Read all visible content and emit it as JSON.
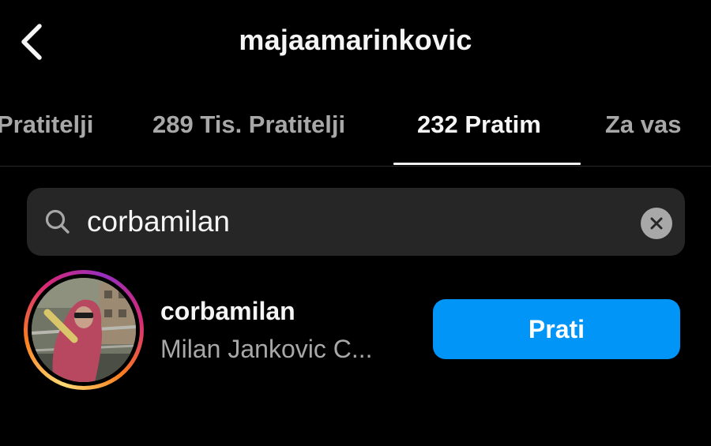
{
  "header": {
    "title": "majaamarinkovic",
    "back_icon": "chevron-left-icon"
  },
  "tabs": [
    {
      "label": "Pratitelji",
      "active": false
    },
    {
      "label": "289 Tis. Pratitelji",
      "active": false
    },
    {
      "label": "232 Pratim",
      "active": true
    },
    {
      "label": "Za vas",
      "active": false
    }
  ],
  "search": {
    "value": "corbamilan",
    "icon": "search-icon",
    "clear_icon": "clear-icon"
  },
  "result": {
    "username": "corbamilan",
    "full_name": "Milan Jankovic C...",
    "follow_label": "Prati",
    "follow_color": "#0095f6"
  },
  "colors": {
    "background": "#000000",
    "search_background": "#262626",
    "primary_text": "#f5f5f5",
    "secondary_text": "#a8a8a8"
  }
}
